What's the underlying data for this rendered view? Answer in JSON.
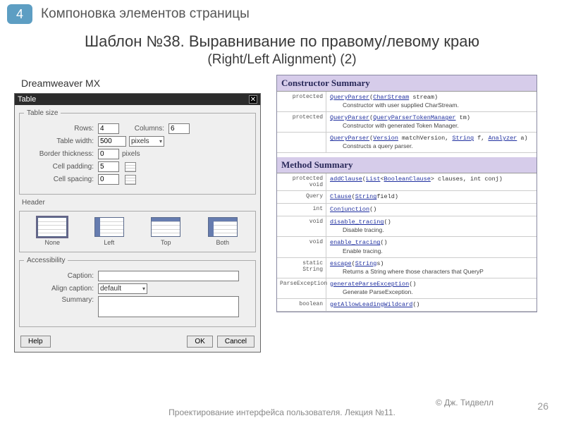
{
  "badge": "4",
  "sectionTitle": "Компоновка элементов страницы",
  "mainTitle": "Шаблон №38. Выравнивание по правому/левому краю",
  "subTitle": "(Right/Left Alignment) (2)",
  "dwLabel": "Dreamweaver MX",
  "dialog": {
    "title": "Table",
    "groups": {
      "size": "Table size",
      "header": "Header",
      "access": "Accessibility"
    },
    "labels": {
      "rows": "Rows:",
      "columns": "Columns:",
      "tableWidth": "Table width:",
      "borderThickness": "Border thickness:",
      "cellPadding": "Cell padding:",
      "cellSpacing": "Cell spacing:",
      "caption": "Caption:",
      "alignCaption": "Align caption:",
      "summary": "Summary:",
      "pixels": "pixels"
    },
    "values": {
      "rows": "4",
      "columns": "6",
      "tableWidth": "500",
      "widthUnit": "pixels",
      "borderThickness": "0",
      "cellPadding": "5",
      "cellSpacing": "0",
      "caption": "",
      "alignCaption": "default",
      "summary": ""
    },
    "headerOptions": [
      "None",
      "Left",
      "Top",
      "Both"
    ],
    "buttons": {
      "help": "Help",
      "ok": "OK",
      "cancel": "Cancel"
    }
  },
  "doc": {
    "constructorHeading": "Constructor Summary",
    "constructors": [
      {
        "mod": "protected",
        "cls": "QueryParser",
        "args": [
          [
            "CharStream",
            "stream"
          ]
        ],
        "desc": "Constructor with user supplied CharStream."
      },
      {
        "mod": "protected",
        "cls": "QueryParser",
        "args": [
          [
            "QueryParserTokenManager",
            "tm"
          ]
        ],
        "desc": "Constructor with generated Token Manager."
      },
      {
        "mod": "",
        "cls": "QueryParser",
        "args": [
          [
            "Version",
            "matchVersion"
          ],
          [
            "String",
            "f"
          ],
          [
            "Analyzer",
            "a"
          ]
        ],
        "desc": "Constructs a query parser."
      }
    ],
    "methodHeading": "Method Summary",
    "methods": [
      {
        "mod": "protected void",
        "name": "addClause",
        "args": [
          [
            "List",
            "<"
          ],
          [
            "BooleanClause",
            ">"
          ],
          [
            "",
            " clauses, int conj"
          ]
        ],
        "desc": ""
      },
      {
        "mod": "Query",
        "name": "Clause",
        "args": [
          [
            "String",
            "field"
          ]
        ],
        "desc": ""
      },
      {
        "mod": "int",
        "name": "Conjunction",
        "args": [],
        "desc": ""
      },
      {
        "mod": "void",
        "name": "disable_tracing",
        "args": [],
        "desc": "Disable tracing."
      },
      {
        "mod": "void",
        "name": "enable_tracing",
        "args": [],
        "desc": "Enable tracing."
      },
      {
        "mod": "static String",
        "name": "escape",
        "args": [
          [
            "String",
            "s"
          ]
        ],
        "desc": "Returns a String where those characters that QueryP"
      },
      {
        "mod": "ParseException",
        "name": "generateParseException",
        "args": [],
        "desc": "Generate ParseException."
      },
      {
        "mod": "boolean",
        "name": "getAllowLeadingWildcard",
        "args": [],
        "desc": ""
      }
    ]
  },
  "footer": {
    "lecture": "Проектирование интерфейса пользователя. Лекция №11.",
    "author": "© Дж. Тидвелл",
    "page": "26"
  }
}
